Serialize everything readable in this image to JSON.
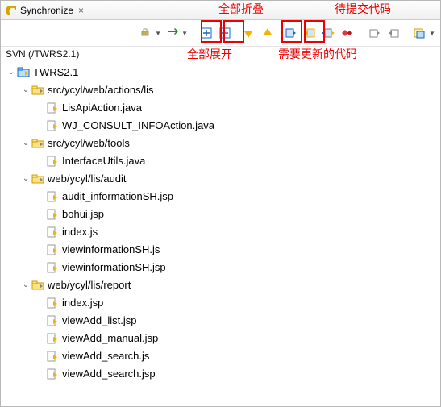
{
  "titlebar": {
    "label": "Synchronize",
    "close": "×"
  },
  "annotations": {
    "collapse_all": "全部折叠",
    "pending_commit": "待提交代码",
    "expand_all": "全部展开",
    "needs_update": "需要更新的代码"
  },
  "breadcrumb": {
    "text": "SVN (/TWRS2.1)"
  },
  "tree": {
    "root": {
      "label": "TWRS2.1",
      "children": [
        {
          "label": "src/ycyl/web/actions/lis",
          "type": "folder",
          "children": [
            {
              "label": "LisApiAction.java",
              "type": "file-out"
            },
            {
              "label": "WJ_CONSULT_INFOAction.java",
              "type": "file-out"
            }
          ]
        },
        {
          "label": "src/ycyl/web/tools",
          "type": "folder",
          "children": [
            {
              "label": "InterfaceUtils.java",
              "type": "file-out"
            }
          ]
        },
        {
          "label": "web/ycyl/lis/audit",
          "type": "folder",
          "children": [
            {
              "label": "audit_informationSH.jsp",
              "type": "file-out"
            },
            {
              "label": "bohui.jsp",
              "type": "file-out"
            },
            {
              "label": "index.js",
              "type": "file-out"
            },
            {
              "label": "viewinformationSH.js",
              "type": "file-out"
            },
            {
              "label": "viewinformationSH.jsp",
              "type": "file-out"
            }
          ]
        },
        {
          "label": "web/ycyl/lis/report",
          "type": "folder",
          "children": [
            {
              "label": "index.jsp",
              "type": "file-out"
            },
            {
              "label": "viewAdd_list.jsp",
              "type": "file-out"
            },
            {
              "label": "viewAdd_manual.jsp",
              "type": "file-out"
            },
            {
              "label": "viewAdd_search.js",
              "type": "file-out"
            },
            {
              "label": "viewAdd_search.jsp",
              "type": "file-out"
            }
          ]
        }
      ]
    }
  }
}
